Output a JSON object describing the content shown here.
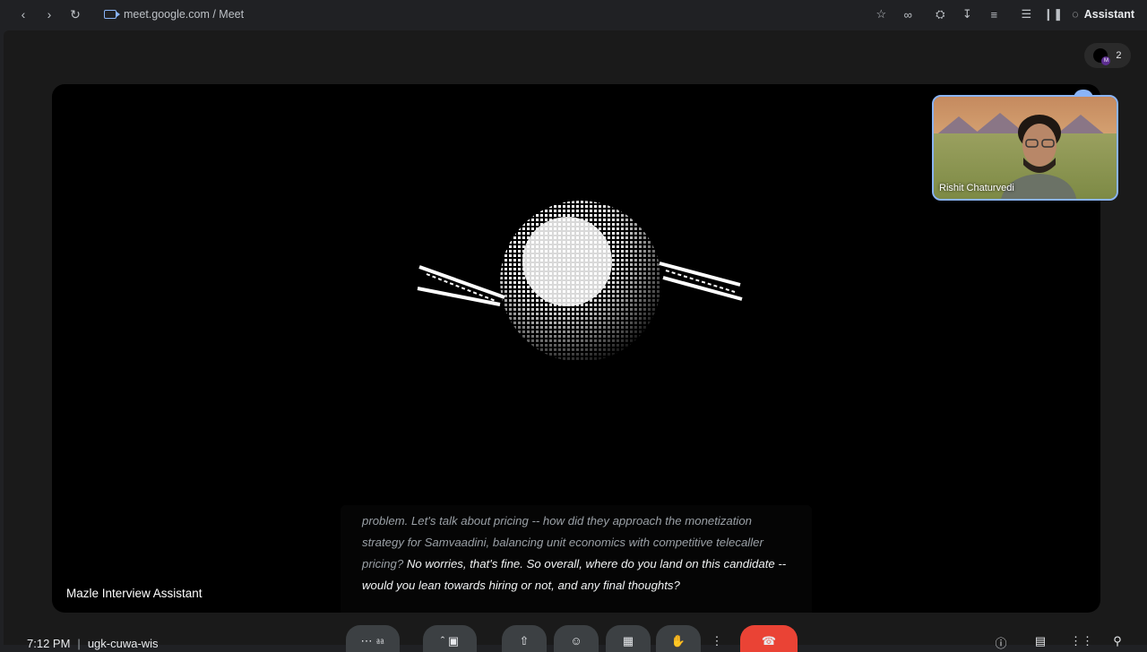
{
  "browser": {
    "url_text": "meet.google.com / Meet",
    "assistant_label": "Assistant",
    "nav": [
      "back-icon",
      "forward-icon",
      "reload-icon"
    ],
    "toolbar_icons": [
      "bookmark-star-icon",
      "link-icon",
      "extensions-icon",
      "download-icon",
      "tab-search-icon",
      "reading-list-icon",
      "audio-icon"
    ]
  },
  "meet": {
    "participant_count": "2",
    "stage_label": "Mazle Interview Assistant",
    "captions": {
      "faded": "problem. Let's talk about pricing -- how did they approach the monetization strategy for Samvaadini, balancing unit economics with competitive telecaller pricing?",
      "fresh": "No worries, that's fine. So overall, where do you land on this candidate -- would you lean towards hiring or not, and any final thoughts?"
    },
    "self_tile": {
      "name": "Rishit Chaturvedi"
    },
    "bottom": {
      "time": "7:12 PM",
      "meeting_code": "ugk-cuwa-wis",
      "controls": [
        "more-options-icon",
        "mic-icon",
        "chevron-up-icon",
        "camera-icon",
        "present-icon",
        "emoji-icon",
        "captions-icon",
        "raise-hand-icon",
        "more-vert-icon",
        "end-call-icon"
      ],
      "right_controls": [
        "info-icon",
        "chat-icon",
        "activities-icon",
        "lock-icon"
      ]
    }
  },
  "colors": {
    "accent": "#8ab4f8",
    "end_call": "#ea4335",
    "background": "#000000"
  }
}
